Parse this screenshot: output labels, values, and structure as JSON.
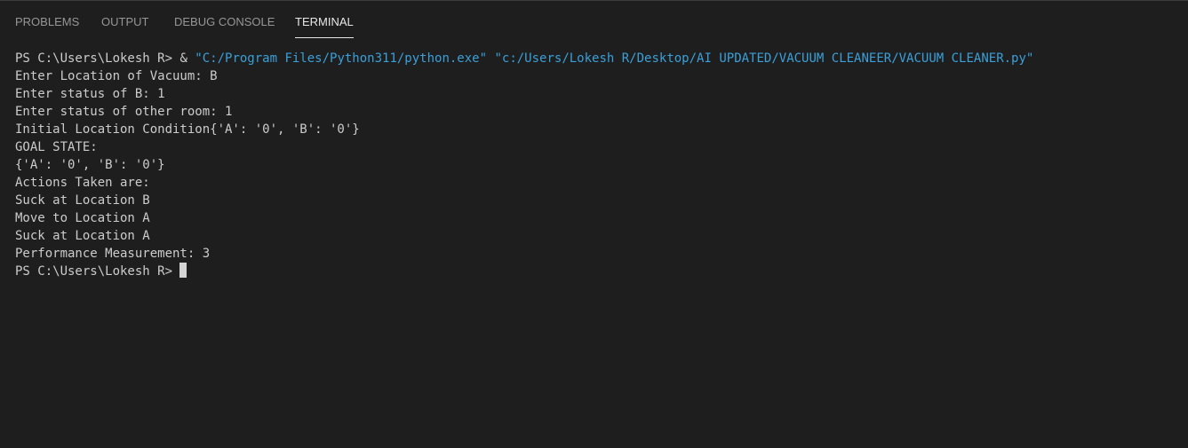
{
  "tabs": [
    {
      "label": "PROBLEMS",
      "active": false
    },
    {
      "label": "OUTPUT",
      "active": false
    },
    {
      "label": "DEBUG CONSOLE",
      "active": false
    },
    {
      "label": "TERMINAL",
      "active": true
    }
  ],
  "terminal": {
    "command": {
      "prompt": "PS C:\\Users\\Lokesh R> ",
      "operator": "& ",
      "exe": "\"C:/Program Files/Python311/python.exe\"",
      "sep": " ",
      "script": "\"c:/Users/Lokesh R/Desktop/AI UPDATED/VACUUM CLEANEER/VACUUM CLEANER.py\""
    },
    "lines": [
      "Enter Location of Vacuum: B",
      "Enter status of B: 1",
      "Enter status of other room: 1",
      "Initial Location Condition{'A': '0', 'B': '0'}",
      "GOAL STATE:",
      "{'A': '0', 'B': '0'}",
      "Actions Taken are:",
      "Suck at Location B",
      "Move to Location A",
      "Suck at Location A",
      "Performance Measurement: 3"
    ],
    "final_prompt": "PS C:\\Users\\Lokesh R>"
  },
  "colors": {
    "background": "#1e1e1e",
    "text": "#cccccc",
    "string": "#3b9fd8",
    "tab_inactive": "#969696",
    "tab_active": "#e7e7e7"
  }
}
